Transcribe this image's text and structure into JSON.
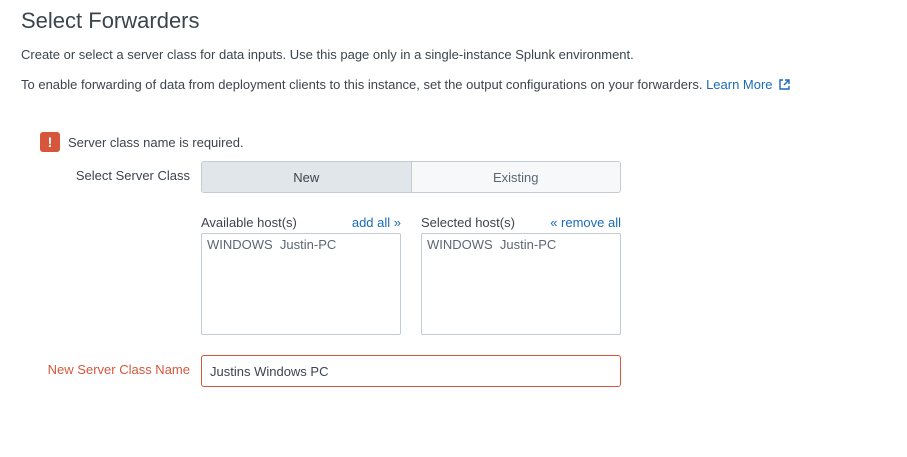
{
  "page": {
    "title": "Select Forwarders",
    "description_line1": "Create or select a server class for data inputs. Use this page only in a single-instance Splunk environment.",
    "description_line2": "To enable forwarding of data from deployment clients to this instance, set the output configurations on your forwarders.",
    "learn_more_label": "Learn More",
    "learn_more_icon": "external-link-icon"
  },
  "error": {
    "icon_symbol": "!",
    "icon_name": "error-icon",
    "message": "Server class name is required.",
    "color": "#d6563c"
  },
  "server_class": {
    "label": "Select Server Class",
    "options": [
      "New",
      "Existing"
    ],
    "selected": "New"
  },
  "hosts": {
    "available_label": "Available host(s)",
    "add_all_label": "add all »",
    "available_items": [
      "WINDOWS  Justin-PC"
    ],
    "selected_label": "Selected host(s)",
    "remove_all_label": "« remove all",
    "selected_items": [
      "WINDOWS  Justin-PC"
    ]
  },
  "new_server_class": {
    "label": "New Server Class Name",
    "value": "Justins Windows PC"
  },
  "colors": {
    "link": "#1a6bb8",
    "error": "#d6563c",
    "text": "#3c444d"
  }
}
